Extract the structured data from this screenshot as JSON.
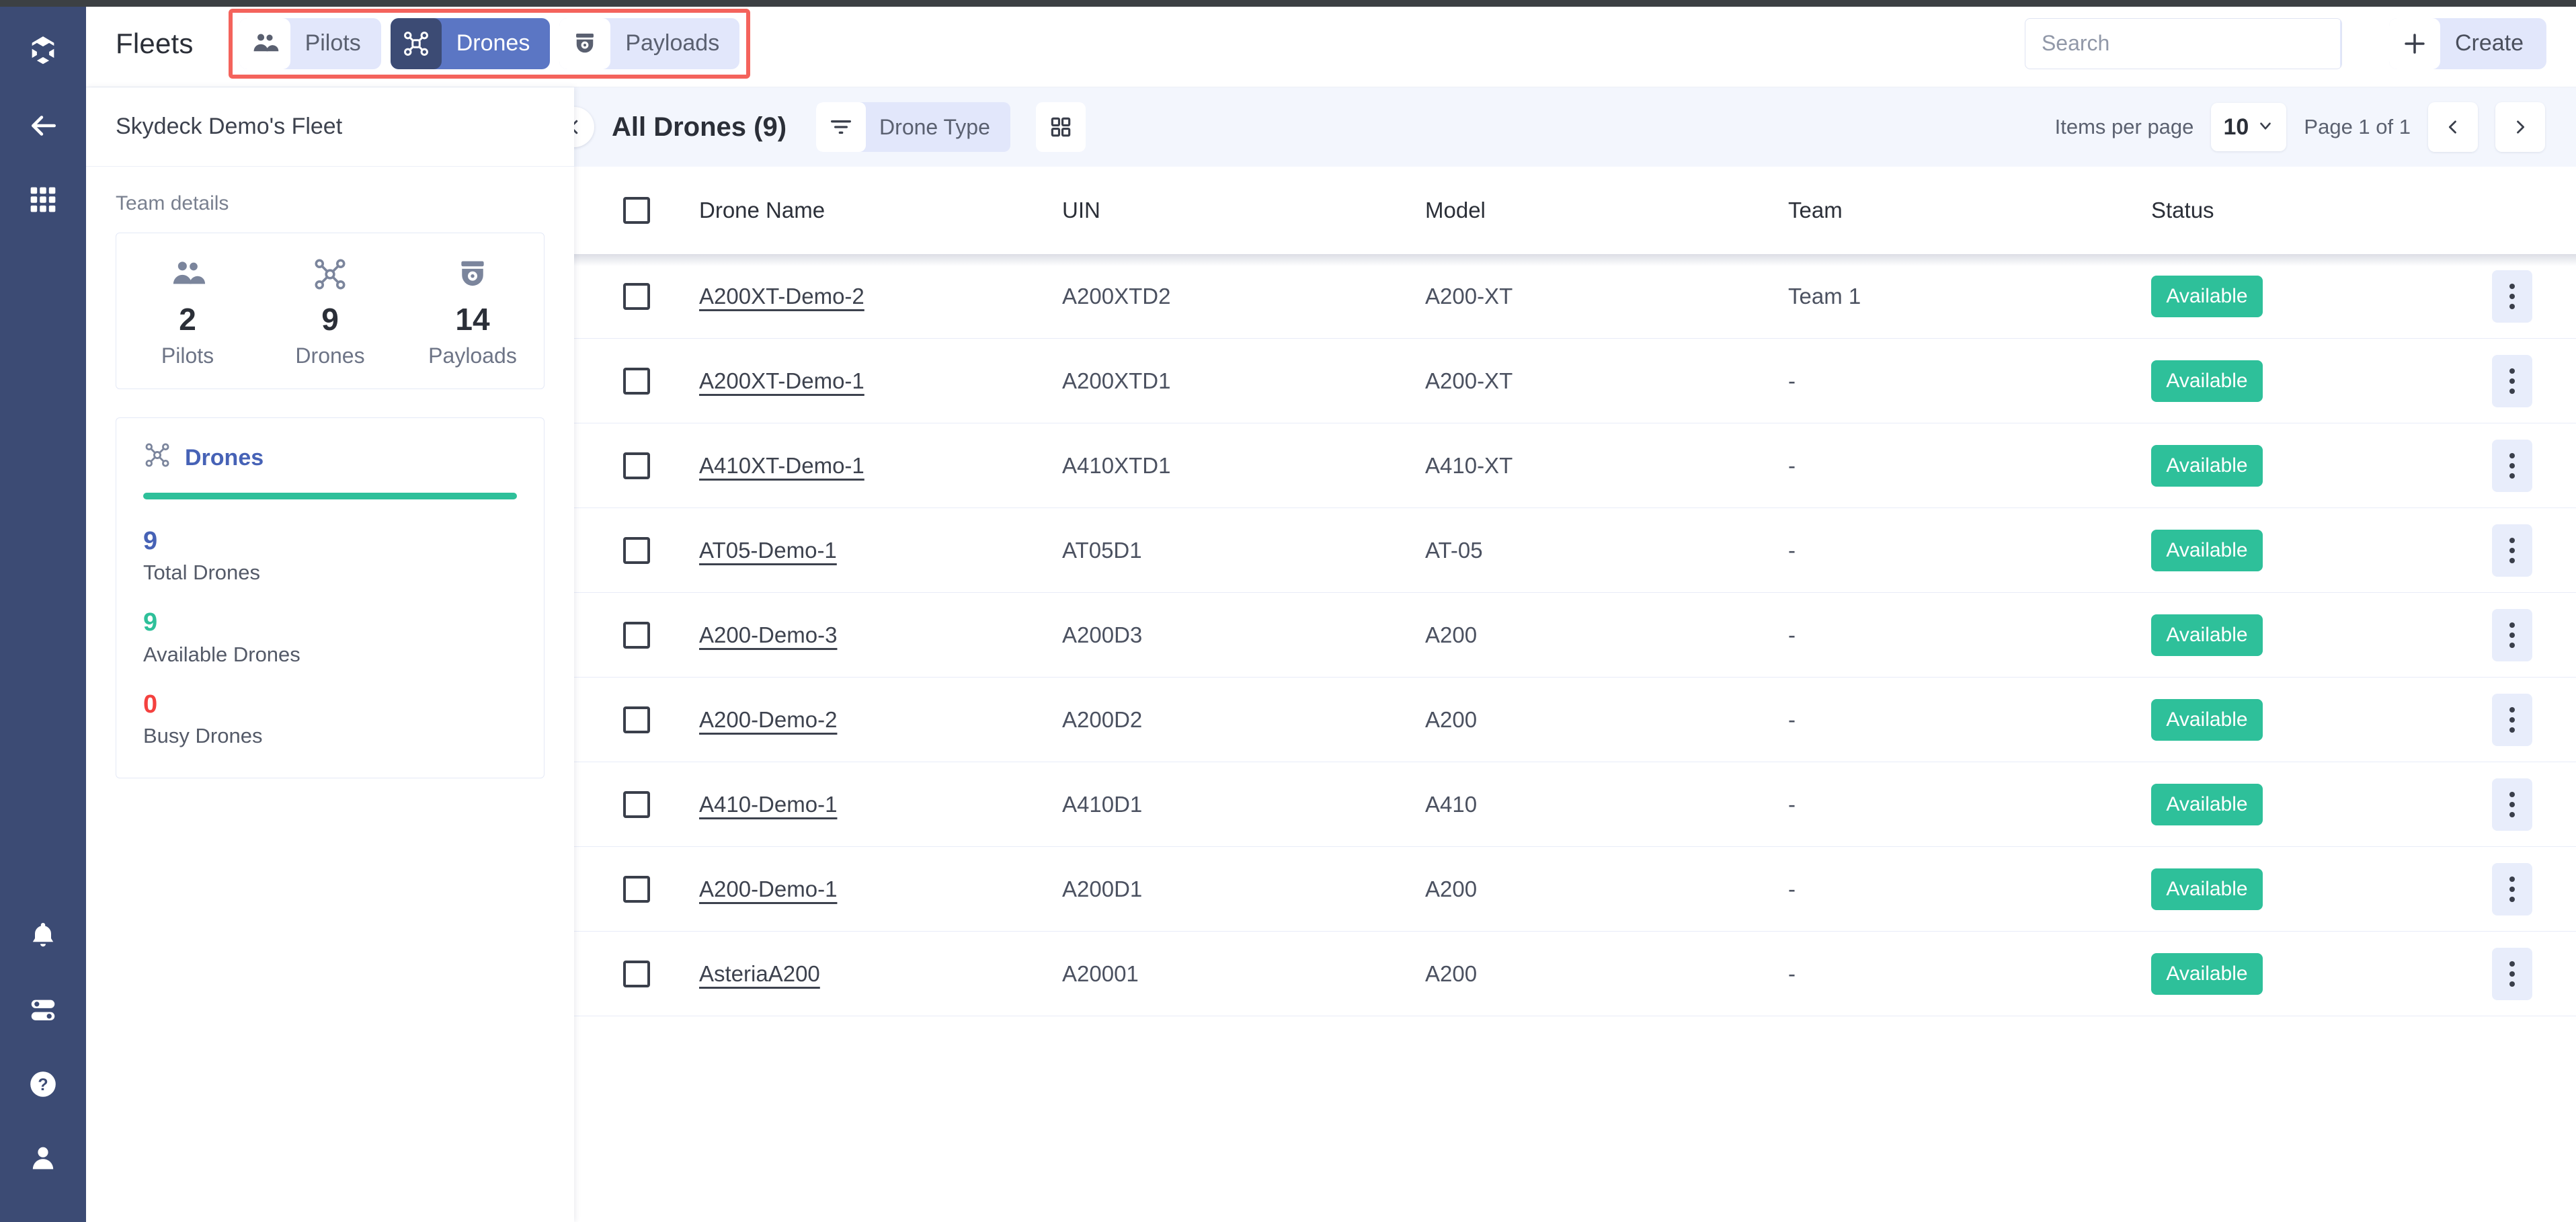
{
  "header": {
    "title": "Fleets",
    "tabs": [
      {
        "label": "Pilots",
        "icon": "pilots-icon",
        "active": false
      },
      {
        "label": "Drones",
        "icon": "drones-icon",
        "active": true
      },
      {
        "label": "Payloads",
        "icon": "payloads-icon",
        "active": false
      }
    ],
    "search": {
      "value": "",
      "placeholder": "Search",
      "icon": "search-icon"
    },
    "create": {
      "label": "Create",
      "icon": "plus-icon"
    }
  },
  "rail": {
    "items": [
      {
        "name": "app-logo-icon"
      },
      {
        "name": "back-arrow-icon"
      },
      {
        "name": "apps-grid-icon"
      },
      {
        "name": "notifications-bell-icon"
      },
      {
        "name": "toggles-icon"
      },
      {
        "name": "help-icon"
      },
      {
        "name": "account-icon"
      }
    ]
  },
  "detail": {
    "fleet_name": "Skydeck Demo's Fleet",
    "team_details_label": "Team details",
    "stats": [
      {
        "icon": "pilots-icon",
        "value": "2",
        "caption": "Pilots"
      },
      {
        "icon": "drones-icon",
        "value": "9",
        "caption": "Drones"
      },
      {
        "icon": "payloads-icon",
        "value": "14",
        "caption": "Payloads"
      }
    ],
    "drones_card": {
      "title": "Drones",
      "icon": "drones-icon",
      "bar_color": "#2ec09a",
      "rows": [
        {
          "value": "9",
          "label": "Total Drones",
          "color": "#4662b6"
        },
        {
          "value": "9",
          "label": "Available Drones",
          "color": "#2ec09a"
        },
        {
          "value": "0",
          "label": "Busy Drones",
          "color": "#f4413f"
        }
      ]
    }
  },
  "toolbar": {
    "collapse_icon": "chevron-left-icon",
    "title": "All Drones (9)",
    "filter": {
      "label": "Drone Type",
      "icon": "filter-icon"
    },
    "grid_toggle_icon": "grid-view-icon",
    "items_per_page_label": "Items per page",
    "items_per_page_value": "10",
    "page_label": "Page 1 of 1",
    "prev_icon": "chevron-left-icon",
    "next_icon": "chevron-right-icon"
  },
  "table": {
    "columns": [
      "Drone Name",
      "UIN",
      "Model",
      "Team",
      "Status"
    ],
    "rows": [
      {
        "name": "A200XT-Demo-2",
        "uin": "A200XTD2",
        "model": "A200-XT",
        "team": "Team 1",
        "status": "Available"
      },
      {
        "name": "A200XT-Demo-1",
        "uin": "A200XTD1",
        "model": "A200-XT",
        "team": "-",
        "status": "Available"
      },
      {
        "name": "A410XT-Demo-1",
        "uin": "A410XTD1",
        "model": "A410-XT",
        "team": "-",
        "status": "Available"
      },
      {
        "name": "AT05-Demo-1",
        "uin": "AT05D1",
        "model": "AT-05",
        "team": "-",
        "status": "Available"
      },
      {
        "name": "A200-Demo-3",
        "uin": "A200D3",
        "model": "A200",
        "team": "-",
        "status": "Available"
      },
      {
        "name": "A200-Demo-2",
        "uin": "A200D2",
        "model": "A200",
        "team": "-",
        "status": "Available"
      },
      {
        "name": "A410-Demo-1",
        "uin": "A410D1",
        "model": "A410",
        "team": "-",
        "status": "Available"
      },
      {
        "name": "A200-Demo-1",
        "uin": "A200D1",
        "model": "A200",
        "team": "-",
        "status": "Available"
      },
      {
        "name": "AsteriaA200",
        "uin": "A20001",
        "model": "A200",
        "team": "-",
        "status": "Available"
      }
    ]
  },
  "colors": {
    "rail": "#3c4b74",
    "accent_blue": "#5b76c4",
    "chip_blue": "#e2e7fb",
    "status_green": "#2ec09a",
    "highlight_red": "#f4635c",
    "busy_red": "#f4413f",
    "toolbar_bg": "#f3f6fd"
  }
}
